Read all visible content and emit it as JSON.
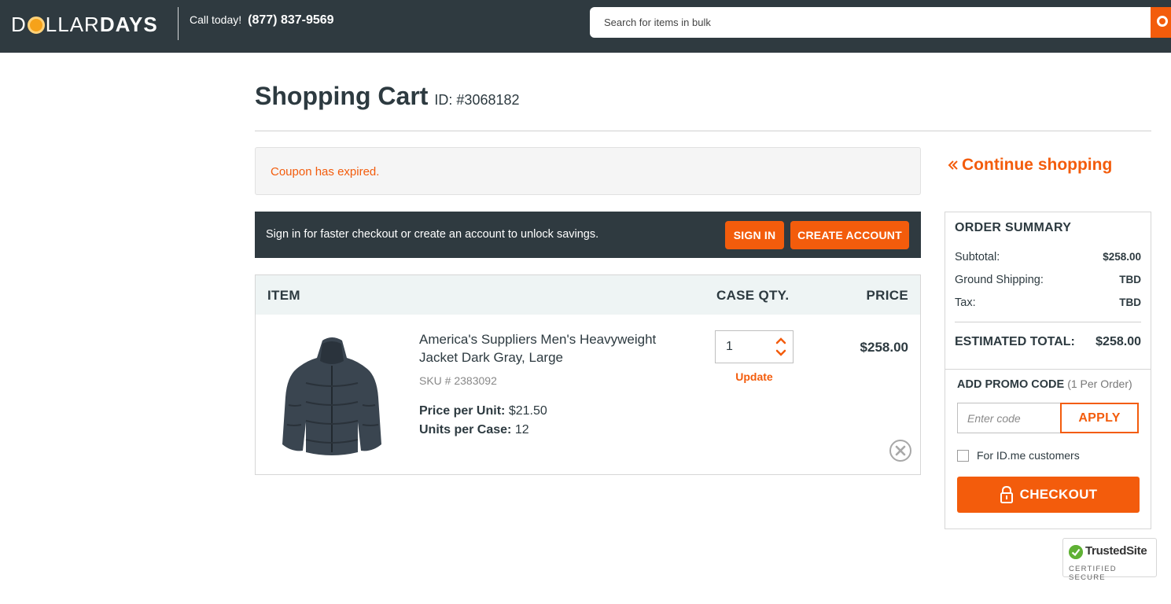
{
  "header": {
    "logo_part1": "D",
    "logo_part2": "LLAR",
    "logo_part3": "DAYS",
    "call_label": "Call today!",
    "phone": "(877) 837-9569",
    "search_placeholder": "Search for items in bulk"
  },
  "page": {
    "title": "Shopping Cart",
    "cart_id": "ID: #3068182"
  },
  "alert": {
    "message": "Coupon has expired."
  },
  "signin_bar": {
    "message": "Sign in for faster checkout or create an account to unlock savings.",
    "signin_label": "SIGN IN",
    "create_label": "CREATE ACCOUNT"
  },
  "cart": {
    "headers": {
      "item": "ITEM",
      "qty": "CASE QTY.",
      "price": "PRICE"
    },
    "items": [
      {
        "name": "America's Suppliers Men's Heavyweight Jacket Dark Gray, Large",
        "sku": "SKU # 2383092",
        "price_per_unit_label": "Price per Unit:",
        "price_per_unit": "$21.50",
        "units_per_case_label": "Units per Case:",
        "units_per_case": "12",
        "qty": "1",
        "update_label": "Update",
        "price": "$258.00"
      }
    ]
  },
  "continue_label": "Continue shopping",
  "summary": {
    "title": "ORDER SUMMARY",
    "subtotal_label": "Subtotal:",
    "subtotal": "$258.00",
    "shipping_label": "Ground Shipping:",
    "shipping": "TBD",
    "tax_label": "Tax:",
    "tax": "TBD",
    "estimated_label": "ESTIMATED TOTAL:",
    "estimated": "$258.00",
    "promo_label": "ADD PROMO CODE",
    "promo_note": "(1 Per Order)",
    "promo_placeholder": "Enter code",
    "apply_label": "APPLY",
    "idme_label": "For ID.me customers",
    "checkout_label": "CHECKOUT"
  },
  "trusted": {
    "name": "TrustedSite",
    "tagline": "CERTIFIED SECURE"
  },
  "colors": {
    "accent": "#f35c0c",
    "header_bg": "#2f3a40",
    "table_head_bg": "#eef4f4"
  }
}
